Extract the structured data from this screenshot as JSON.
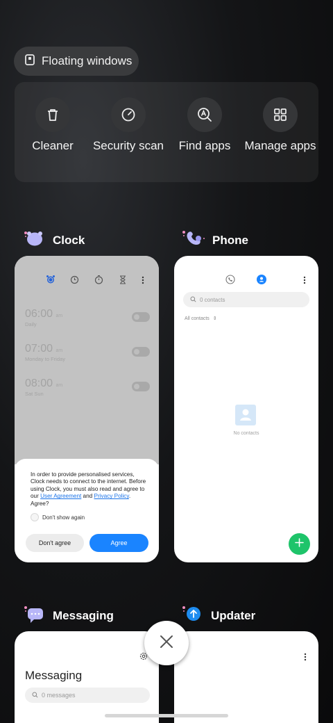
{
  "floating_windows": {
    "label": "Floating windows"
  },
  "quick_actions": [
    {
      "label": "Cleaner",
      "icon": "trash-icon"
    },
    {
      "label": "Security scan",
      "icon": "security-scan-icon"
    },
    {
      "label": "Find apps",
      "icon": "find-apps-icon"
    },
    {
      "label": "Manage apps",
      "icon": "grid-icon"
    }
  ],
  "apps": {
    "clock": {
      "name": "Clock",
      "alarms": [
        {
          "time": "06:00",
          "ampm": "am",
          "repeat": "Daily"
        },
        {
          "time": "07:00",
          "ampm": "am",
          "repeat": "Monday to Friday"
        },
        {
          "time": "08:00",
          "ampm": "am",
          "repeat": "Sat Sun"
        }
      ],
      "dialog": {
        "text_before": "In order to provide personalised services, Clock needs to connect to the internet. Before using Clock, you must also read and agree to our ",
        "link1": "User Agreement",
        "and": " and ",
        "link2": "Privacy Policy",
        "text_after": ". Agree?",
        "checkbox": "Don't show again",
        "disagree": "Don't agree",
        "agree": "Agree"
      }
    },
    "phone": {
      "name": "Phone",
      "search_placeholder": "0 contacts",
      "filter": "All contacts",
      "empty": "No contacts"
    },
    "messaging": {
      "name": "Messaging",
      "title": "Messaging",
      "search_placeholder": "0 messages"
    },
    "updater": {
      "name": "Updater"
    }
  },
  "colors": {
    "accent_blue": "#1a84ff",
    "fab_green": "#1ec46a"
  }
}
